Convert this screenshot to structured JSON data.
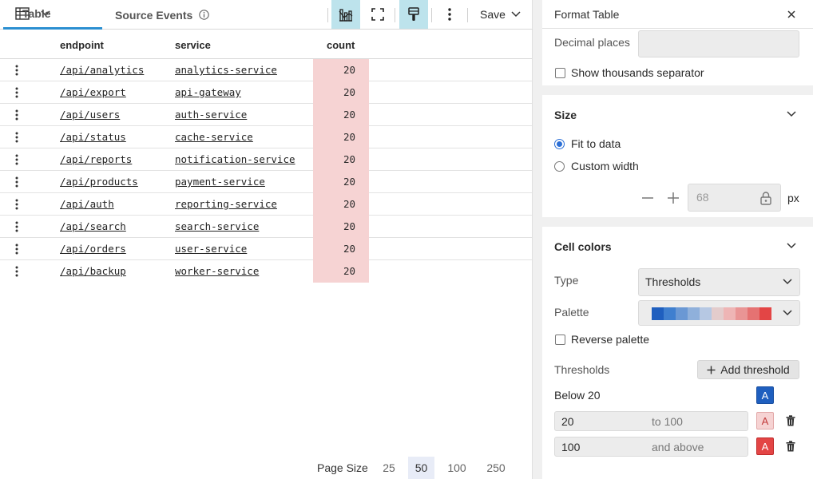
{
  "toolbar": {
    "table_tab_label": "Table",
    "source_tab_label": "Source Events",
    "save_label": "Save"
  },
  "table": {
    "columns": [
      "endpoint",
      "service",
      "count"
    ],
    "rows": [
      {
        "endpoint": "/api/analytics",
        "service": "analytics-service",
        "count": "20"
      },
      {
        "endpoint": "/api/export",
        "service": "api-gateway",
        "count": "20"
      },
      {
        "endpoint": "/api/users",
        "service": "auth-service",
        "count": "20"
      },
      {
        "endpoint": "/api/status",
        "service": "cache-service",
        "count": "20"
      },
      {
        "endpoint": "/api/reports",
        "service": "notification-service",
        "count": "20"
      },
      {
        "endpoint": "/api/products",
        "service": "payment-service",
        "count": "20"
      },
      {
        "endpoint": "/api/auth",
        "service": "reporting-service",
        "count": "20"
      },
      {
        "endpoint": "/api/search",
        "service": "search-service",
        "count": "20"
      },
      {
        "endpoint": "/api/orders",
        "service": "user-service",
        "count": "20"
      },
      {
        "endpoint": "/api/backup",
        "service": "worker-service",
        "count": "20"
      }
    ]
  },
  "pager": {
    "label": "Page Size",
    "options": [
      "25",
      "50",
      "100",
      "250"
    ],
    "selected": "50"
  },
  "format_panel": {
    "title": "Format Table",
    "decimal_places_label": "Decimal places",
    "decimal_places_value": "",
    "thousands_separator_label": "Show thousands separator",
    "size": {
      "title": "Size",
      "fit_label": "Fit to data",
      "custom_label": "Custom width",
      "width_value": "68",
      "unit": "px"
    },
    "cell_colors": {
      "title": "Cell colors",
      "type_label": "Type",
      "type_value": "Thresholds",
      "palette_label": "Palette",
      "palette_colors": [
        "#1f5fbf",
        "#3f7fcf",
        "#6a98d4",
        "#8fb0db",
        "#b6c8e3",
        "#e3cccc",
        "#eeb5b5",
        "#e99595",
        "#e57272",
        "#e34545"
      ],
      "reverse_label": "Reverse palette",
      "thresholds_label": "Thresholds",
      "add_threshold_label": "Add threshold",
      "thresholds": [
        {
          "label": "Below 20",
          "from": "",
          "to": "",
          "swatch_letter": "A",
          "color": "#1f5fbf"
        },
        {
          "label": "",
          "from": "20",
          "to": "to 100",
          "swatch_letter": "A",
          "color": "#f6d3d3"
        },
        {
          "label": "",
          "from": "100",
          "to": "and above",
          "swatch_letter": "A",
          "color": "#e34545"
        }
      ]
    }
  }
}
